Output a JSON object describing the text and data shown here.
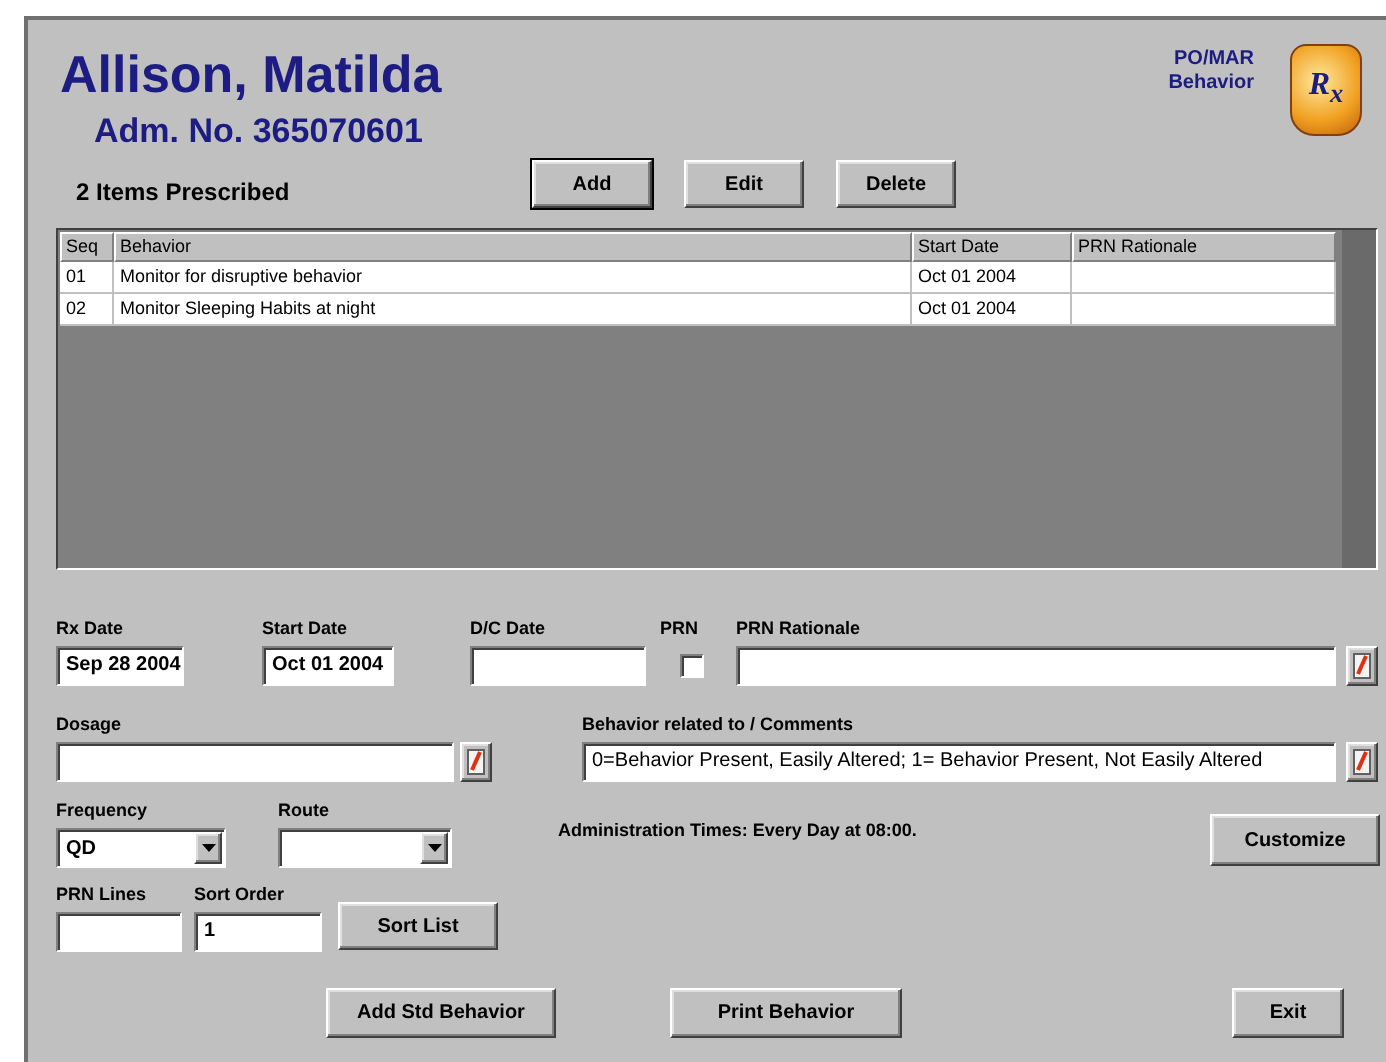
{
  "patient": {
    "name": "Allison, Matilda",
    "admission": "Adm. No. 365070601"
  },
  "module": {
    "line_1": "PO/MAR",
    "line_2": "Behavior",
    "logo": "R$_{x}$"
  },
  "count_label": "2 Items Prescribed",
  "toolbar": [
    {
      "label": "Add",
      "default": true
    },
    {
      "label": "Edit",
      "default": false
    },
    {
      "label": "Delete",
      "default": false
    }
  ],
  "table": {
    "columns": [
      "Seq",
      "Behavior",
      "Start Date",
      "PRN Rationale"
    ],
    "rows": [
      {
        "seq": "01",
        "behavior": "Monitor for disruptive behavior",
        "start_date": "Oct 01 2004"
      },
      {
        "seq": "02",
        "behavior": "Monitor Sleeping Habits at night",
        "start_date": "Oct 01 2004"
      }
    ]
  },
  "form": {
    "rx_date": {
      "label": "Rx Date",
      "value": "Sep 28 2004"
    },
    "start_date": {
      "label": "Start Date",
      "value": "Oct 01 2004"
    },
    "dc_date": {
      "label": "D/C Date"
    },
    "prn": {
      "label": "PRN",
      "checked": false
    },
    "prn_rationale": {
      "label": "PRN Rationale"
    },
    "dosage": {
      "label": "Dosage"
    },
    "comments": {
      "label": "Behavior related to / Comments",
      "value": "0=Behavior Present, Easily Altered; 1= Behavior Present, Not Easily Altered"
    },
    "frequency": {
      "label": "Frequency",
      "value": "QD"
    },
    "route": {
      "label": "Route"
    },
    "admin_times": "Administration Times: Every Day at 08:00.",
    "customize": "Customize",
    "prn_lines": {
      "label": "PRN Lines"
    },
    "sort_order": {
      "label": "Sort Order",
      "value": "1"
    },
    "sort_list": "Sort List"
  },
  "footer_buttons": [
    "Add Std Behavior",
    "Print Behavior",
    "Exit"
  ]
}
